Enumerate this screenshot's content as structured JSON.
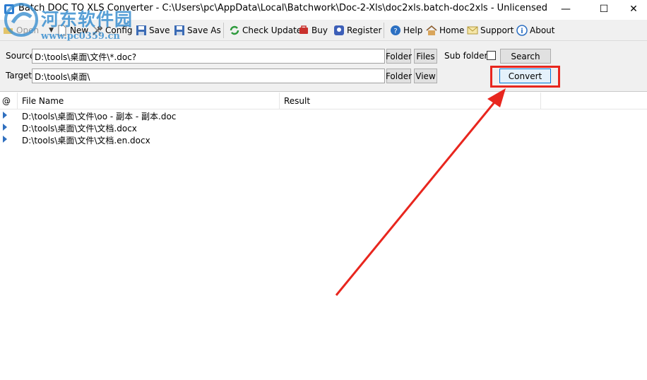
{
  "window": {
    "title": "Batch DOC TO XLS Converter - C:\\Users\\pc\\AppData\\Local\\Batchwork\\Doc-2-Xls\\doc2xls.batch-doc2xls - Unlicensed",
    "minimize": "—",
    "maximize": "☐",
    "close": "✕"
  },
  "watermark": {
    "text": "河东软件园",
    "url": "www.pc0359.cn"
  },
  "toolbar": {
    "open": "Open",
    "new": "New",
    "config": "Config",
    "save": "Save",
    "save_as": "Save As",
    "check_update": "Check Update",
    "buy": "Buy",
    "register": "Register",
    "help": "Help",
    "home": "Home",
    "support": "Support",
    "about": "About"
  },
  "source": {
    "label": "Source",
    "value": "D:\\tools\\桌面\\文件\\*.doc?",
    "folder_button": "Folder",
    "files_button": "Files",
    "subfolders_label": "Sub folders",
    "subfolders_checked": false,
    "search_button": "Search"
  },
  "target": {
    "label": "Target",
    "value": "D:\\tools\\桌面\\",
    "folder_button": "Folder",
    "view_button": "View",
    "convert_button": "Convert"
  },
  "table": {
    "columns": [
      "@",
      "File Name",
      "Result"
    ],
    "rows": [
      {
        "file": "D:\\tools\\桌面\\文件\\oo - 副本 - 副本.doc",
        "result": ""
      },
      {
        "file": "D:\\tools\\桌面\\文件\\文档.docx",
        "result": ""
      },
      {
        "file": "D:\\tools\\桌面\\文件\\文档.en.docx",
        "result": ""
      }
    ]
  },
  "colors": {
    "annotation": "#e8261e",
    "accent": "#0078d7",
    "row_arrow": "#2f6fbf"
  }
}
